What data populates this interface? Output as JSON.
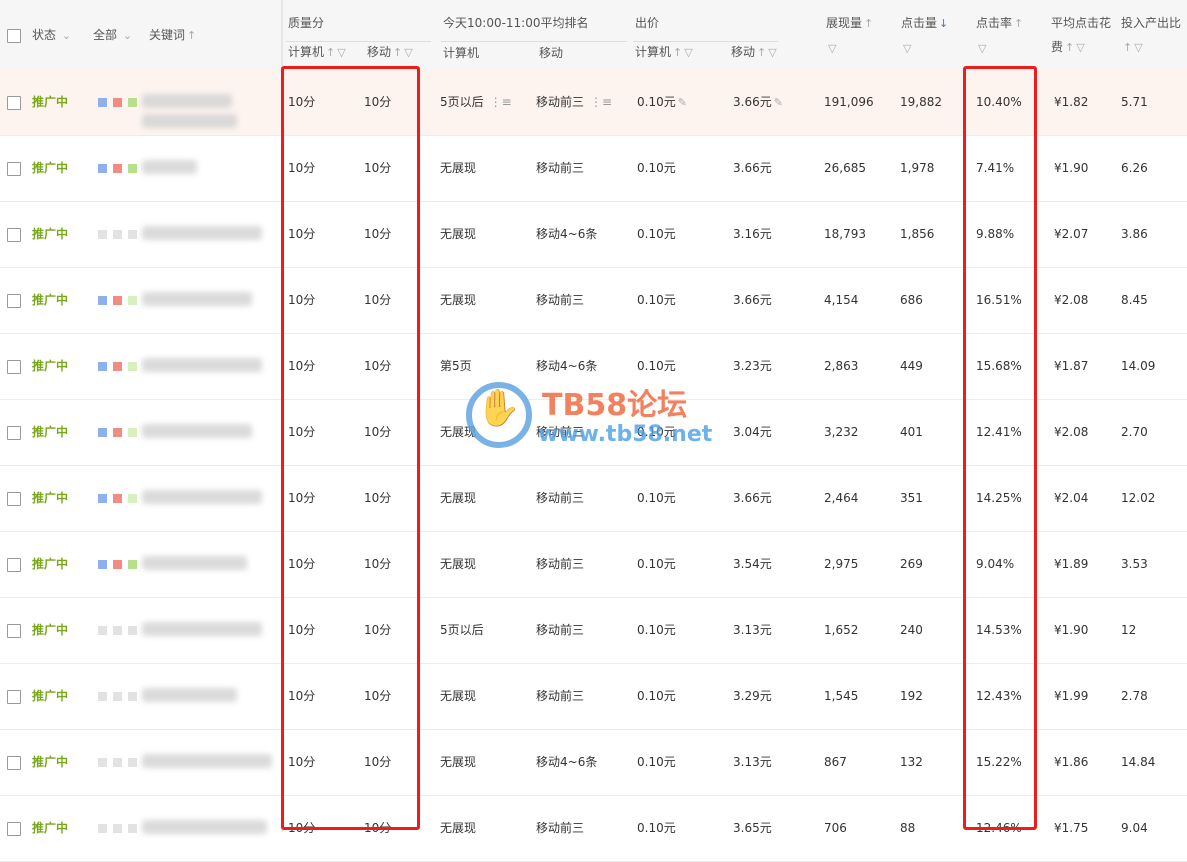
{
  "header": {
    "status_label": "状态",
    "all_label": "全部",
    "keyword_label": "关键词",
    "quality_group": "质量分",
    "quality_pc": "计算机",
    "quality_mobile": "移动",
    "rank_group": "今天10:00-11:00平均排名",
    "rank_pc": "计算机",
    "rank_mobile": "移动",
    "bid_group": "出价",
    "bid_pc": "计算机",
    "bid_mobile": "移动",
    "impressions": "展现量",
    "clicks": "点击量",
    "ctr": "点击率",
    "avg_cpc_line1": "平均点击花",
    "avg_cpc_line2": "费",
    "roi": "投入产出比"
  },
  "icons": {
    "sort_up": "↑",
    "sort_down": "↓",
    "filter": "▽",
    "dropdown": "⌄",
    "edit": "✎",
    "rank_list": "⋮≡"
  },
  "colors": {
    "status_green": "#7aa81b",
    "highlight_red": "#ee1c1c",
    "sort_active": "#3a7bd5"
  },
  "watermark": {
    "title": "TB58论坛",
    "url": "www.tb58.net"
  },
  "rows": [
    {
      "status": "推广中",
      "q_pc": "10分",
      "q_mobile": "10分",
      "rank_pc": "5页以后",
      "rank_mobile": "移动前三",
      "bid_pc": "0.10元",
      "bid_mobile": "3.66元",
      "impressions": "191,096",
      "clicks": "19,882",
      "ctr": "10.40%",
      "cpc": "¥1.82",
      "roi": "5.71"
    },
    {
      "status": "推广中",
      "q_pc": "10分",
      "q_mobile": "10分",
      "rank_pc": "无展现",
      "rank_mobile": "移动前三",
      "bid_pc": "0.10元",
      "bid_mobile": "3.66元",
      "impressions": "26,685",
      "clicks": "1,978",
      "ctr": "7.41%",
      "cpc": "¥1.90",
      "roi": "6.26"
    },
    {
      "status": "推广中",
      "q_pc": "10分",
      "q_mobile": "10分",
      "rank_pc": "无展现",
      "rank_mobile": "移动4~6条",
      "bid_pc": "0.10元",
      "bid_mobile": "3.16元",
      "impressions": "18,793",
      "clicks": "1,856",
      "ctr": "9.88%",
      "cpc": "¥2.07",
      "roi": "3.86"
    },
    {
      "status": "推广中",
      "q_pc": "10分",
      "q_mobile": "10分",
      "rank_pc": "无展现",
      "rank_mobile": "移动前三",
      "bid_pc": "0.10元",
      "bid_mobile": "3.66元",
      "impressions": "4,154",
      "clicks": "686",
      "ctr": "16.51%",
      "cpc": "¥2.08",
      "roi": "8.45"
    },
    {
      "status": "推广中",
      "q_pc": "10分",
      "q_mobile": "10分",
      "rank_pc": "第5页",
      "rank_mobile": "移动4~6条",
      "bid_pc": "0.10元",
      "bid_mobile": "3.23元",
      "impressions": "2,863",
      "clicks": "449",
      "ctr": "15.68%",
      "cpc": "¥1.87",
      "roi": "14.09"
    },
    {
      "status": "推广中",
      "q_pc": "10分",
      "q_mobile": "10分",
      "rank_pc": "无展现",
      "rank_mobile": "移动前三",
      "bid_pc": "0.10元",
      "bid_mobile": "3.04元",
      "impressions": "3,232",
      "clicks": "401",
      "ctr": "12.41%",
      "cpc": "¥2.08",
      "roi": "2.70"
    },
    {
      "status": "推广中",
      "q_pc": "10分",
      "q_mobile": "10分",
      "rank_pc": "无展现",
      "rank_mobile": "移动前三",
      "bid_pc": "0.10元",
      "bid_mobile": "3.66元",
      "impressions": "2,464",
      "clicks": "351",
      "ctr": "14.25%",
      "cpc": "¥2.04",
      "roi": "12.02"
    },
    {
      "status": "推广中",
      "q_pc": "10分",
      "q_mobile": "10分",
      "rank_pc": "无展现",
      "rank_mobile": "移动前三",
      "bid_pc": "0.10元",
      "bid_mobile": "3.54元",
      "impressions": "2,975",
      "clicks": "269",
      "ctr": "9.04%",
      "cpc": "¥1.89",
      "roi": "3.53"
    },
    {
      "status": "推广中",
      "q_pc": "10分",
      "q_mobile": "10分",
      "rank_pc": "5页以后",
      "rank_mobile": "移动前三",
      "bid_pc": "0.10元",
      "bid_mobile": "3.13元",
      "impressions": "1,652",
      "clicks": "240",
      "ctr": "14.53%",
      "cpc": "¥1.90",
      "roi": "12"
    },
    {
      "status": "推广中",
      "q_pc": "10分",
      "q_mobile": "10分",
      "rank_pc": "无展现",
      "rank_mobile": "移动前三",
      "bid_pc": "0.10元",
      "bid_mobile": "3.29元",
      "impressions": "1,545",
      "clicks": "192",
      "ctr": "12.43%",
      "cpc": "¥1.99",
      "roi": "2.78"
    },
    {
      "status": "推广中",
      "q_pc": "10分",
      "q_mobile": "10分",
      "rank_pc": "无展现",
      "rank_mobile": "移动4~6条",
      "bid_pc": "0.10元",
      "bid_mobile": "3.13元",
      "impressions": "867",
      "clicks": "132",
      "ctr": "15.22%",
      "cpc": "¥1.86",
      "roi": "14.84"
    },
    {
      "status": "推广中",
      "q_pc": "10分",
      "q_mobile": "10分",
      "rank_pc": "无展现",
      "rank_mobile": "移动前三",
      "bid_pc": "0.10元",
      "bid_mobile": "3.65元",
      "impressions": "706",
      "clicks": "88",
      "ctr": "12.46%",
      "cpc": "¥1.75",
      "roi": "9.04"
    }
  ]
}
